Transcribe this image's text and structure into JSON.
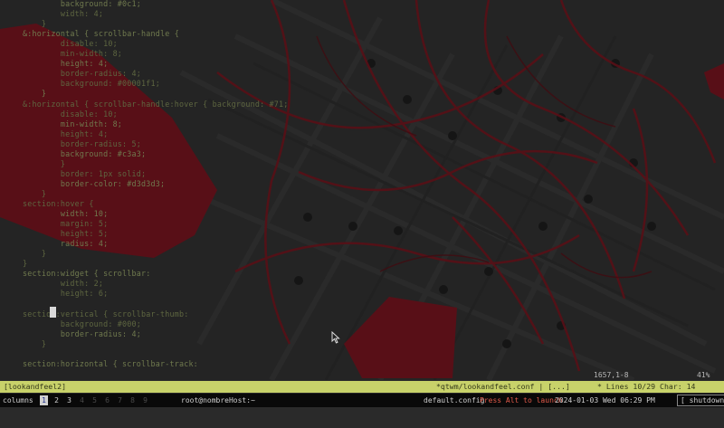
{
  "editor": {
    "lines": [
      "            background: #0c1;",
      "            width: 4;",
      "        }",
      "    &:horizontal { scrollbar-handle {",
      "            disable: 10;",
      "            min-width: 8;",
      "            height: 4;",
      "            border-radius: 4;",
      "            background: #00001f1;",
      "        }",
      "    &:horizontal { scrollbar-handle:hover { background: #71;",
      "            disable: 10;",
      "            min-width: 8;",
      "            height: 4;",
      "            border-radius: 5;",
      "            background: #c3a3;",
      "            }",
      "            border: 1px solid;",
      "            border-color: #d3d3d3;",
      "        }",
      "    section:hover {",
      "            width: 10;",
      "            margin: 5;",
      "            height: 5;",
      "            radius: 4;",
      "        }",
      "    }",
      "    section:widget { scrollbar:",
      "            width: 2;",
      "            height: 6;",
      "",
      "    section:vertical { scrollbar-thumb:",
      "            background: #000;",
      "            border-radius: 4;",
      "        }",
      "",
      "    section:horizontal { scrollbar-track:"
    ],
    "ruler": "1657,1-8",
    "percent": "41%"
  },
  "statusbar": {
    "left": "[lookandfeel2]",
    "middle": "*qtwm/lookandfeel.conf | [...] ",
    "right": "* Lines 10/29 Char: 14"
  },
  "taskbar": {
    "layout": "columns",
    "workspaces": [
      "1",
      "2",
      "3",
      "4",
      "5",
      "6",
      "7",
      "8",
      "9"
    ],
    "active_workspace": "1",
    "window_title": "root@nombreHost:~",
    "config": "default.config",
    "mode": "Press Alt to launch",
    "datetime": "2024-01-03 Wed 06:29 PM",
    "shutdown_label": "[ shutdown ]"
  },
  "colors": {
    "statusbar_bg": "#c8d26a",
    "taskbar_bg": "#090909",
    "accent_red": "#7a1620",
    "code_text": "#5e6640"
  },
  "icons": {
    "mouse": "mouse-pointer-icon"
  }
}
